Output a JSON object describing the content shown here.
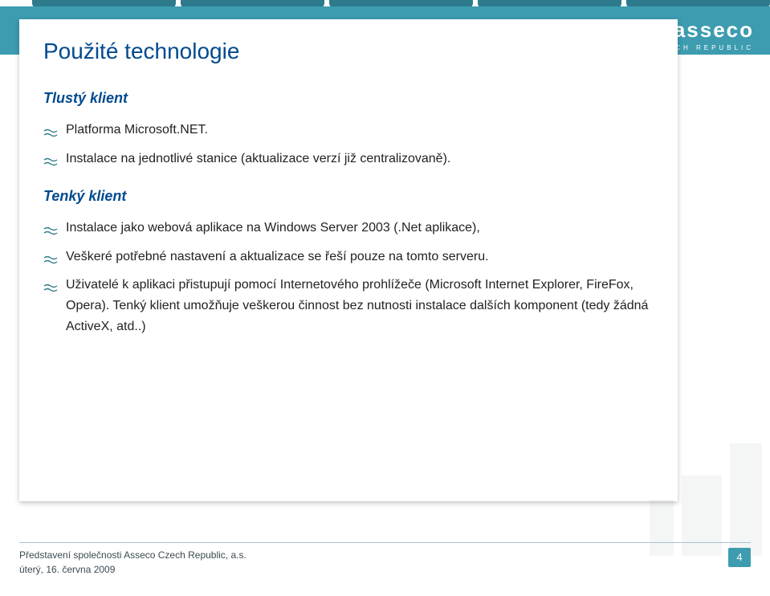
{
  "brand": {
    "name": "asseco",
    "sub": "CZECH REPUBLIC"
  },
  "slide": {
    "title": "Použité technologie",
    "sections": [
      {
        "heading": "Tlustý klient",
        "items": [
          "Platforma Microsoft.NET.",
          "Instalace na jednotlivé stanice (aktualizace verzí již centralizovaně)."
        ]
      },
      {
        "heading": "Tenký klient",
        "items": [
          "Instalace jako webová aplikace na Windows Server 2003 (.Net aplikace),",
          "Veškeré potřebné nastavení a aktualizace se řeší pouze na tomto serveru.",
          "Uživatelé k aplikaci přistupují pomocí Internetového prohlížeče (Microsoft Internet Explorer, FireFox, Opera). Tenký klient umožňuje veškerou činnost bez nutnosti instalace dalších komponent (tedy žádná ActiveX, atd..)"
        ]
      }
    ]
  },
  "footer": {
    "company": "Představení společnosti Asseco Czech Republic, a.s.",
    "date": "úterý, 16. června 2009",
    "page": "4"
  },
  "colors": {
    "brand_teal": "#3d9cb0",
    "heading_blue": "#004a8f"
  }
}
